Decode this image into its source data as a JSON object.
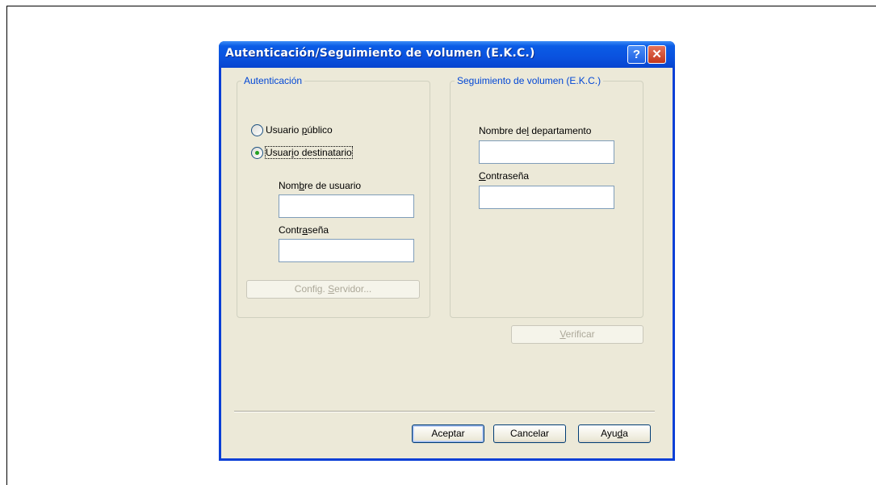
{
  "dialog": {
    "title": "Autenticación/Seguimiento de volumen (E.K.C.)",
    "help_label": "?",
    "close_label": "✕"
  },
  "auth_group": {
    "label": "Autenticación",
    "radio_public": {
      "prefix": "Usuario ",
      "accel": "p",
      "suffix": "úblico",
      "selected": false
    },
    "radio_recipient": {
      "prefix": "Usuar",
      "accel": "i",
      "suffix": "o destinatario",
      "selected": true
    },
    "username": {
      "prefix": "Nom",
      "accel": "b",
      "suffix": "re de usuario",
      "value": ""
    },
    "password": {
      "prefix": "Contr",
      "accel": "a",
      "suffix": "seña",
      "value": ""
    },
    "server_button": {
      "prefix": "Config. ",
      "accel": "S",
      "suffix": "ervidor..."
    }
  },
  "ekc_group": {
    "label": "Seguimiento de volumen (E.K.C.)",
    "department": {
      "prefix": "Nombre de",
      "accel": "l",
      "suffix": " departamento",
      "value": ""
    },
    "password": {
      "prefix": "",
      "accel": "C",
      "suffix": "ontraseña",
      "value": ""
    },
    "verify_button": {
      "prefix": "",
      "accel": "V",
      "suffix": "erificar"
    }
  },
  "footer": {
    "accept_label": "Aceptar",
    "cancel_label": "Cancelar",
    "help": {
      "prefix": "Ayu",
      "accel": "d",
      "suffix": "a"
    }
  },
  "colors": {
    "titlebar": "#0a52df",
    "dialog_face": "#ece9d8",
    "group_label": "#0046d5",
    "close_button": "#c2371c"
  }
}
